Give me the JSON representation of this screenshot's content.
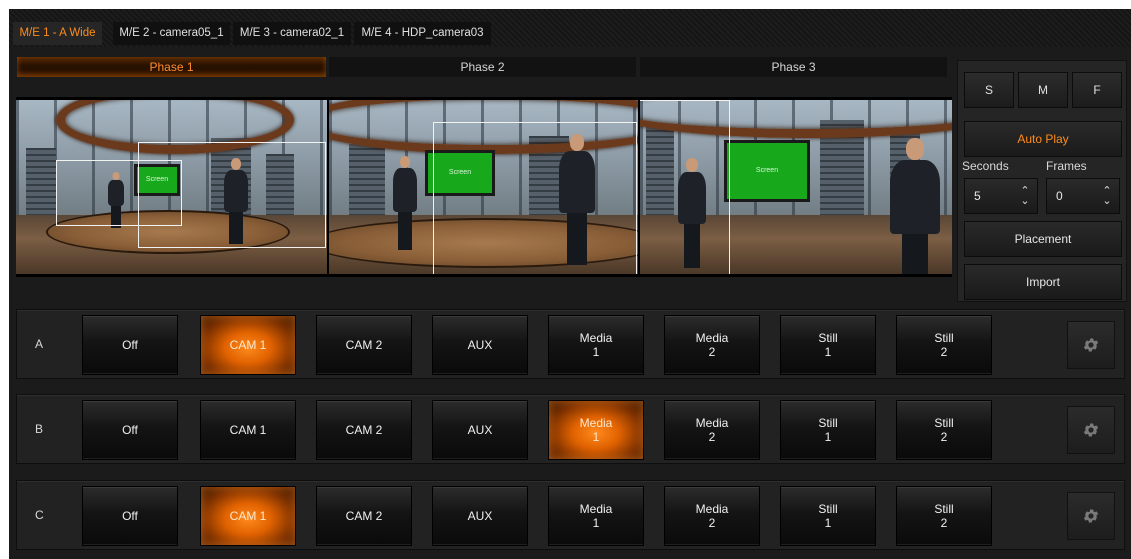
{
  "me_tabs": [
    {
      "label": "M/E 1 - A Wide",
      "active": true
    },
    {
      "label": "M/E 2 - camera05_1",
      "active": false
    },
    {
      "label": "M/E 3 - camera02_1",
      "active": false
    },
    {
      "label": "M/E 4 - HDP_camera03",
      "active": false
    }
  ],
  "phases": [
    {
      "label": "Phase 1",
      "active": true
    },
    {
      "label": "Phase 2",
      "active": false
    },
    {
      "label": "Phase 3",
      "active": false
    }
  ],
  "preview": {
    "screen_labels": [
      "Screen",
      "Screen",
      "Screen"
    ]
  },
  "right_panel": {
    "speed_buttons": [
      "S",
      "M",
      "F"
    ],
    "auto_play": "Auto Play",
    "seconds_label": "Seconds",
    "frames_label": "Frames",
    "seconds_value": "5",
    "frames_value": "0",
    "placement": "Placement",
    "import": "Import"
  },
  "rows": [
    {
      "label": "A",
      "selected": 1,
      "buttons": [
        "Off",
        "CAM 1",
        "CAM 2",
        "AUX",
        "Media\n1",
        "Media\n2",
        "Still\n1",
        "Still\n2"
      ]
    },
    {
      "label": "B",
      "selected": 4,
      "buttons": [
        "Off",
        "CAM 1",
        "CAM 2",
        "AUX",
        "Media\n1",
        "Media\n2",
        "Still\n1",
        "Still\n2"
      ]
    },
    {
      "label": "C",
      "selected": 1,
      "buttons": [
        "Off",
        "CAM 1",
        "CAM 2",
        "AUX",
        "Media\n1",
        "Media\n2",
        "Still\n1",
        "Still\n2"
      ]
    }
  ],
  "icons": {
    "gear": "gear-icon",
    "spin_up": "chevron-up-icon",
    "spin_down": "chevron-down-icon"
  },
  "colors": {
    "accent": "#ff8c1a",
    "background": "#1b1b1b"
  }
}
